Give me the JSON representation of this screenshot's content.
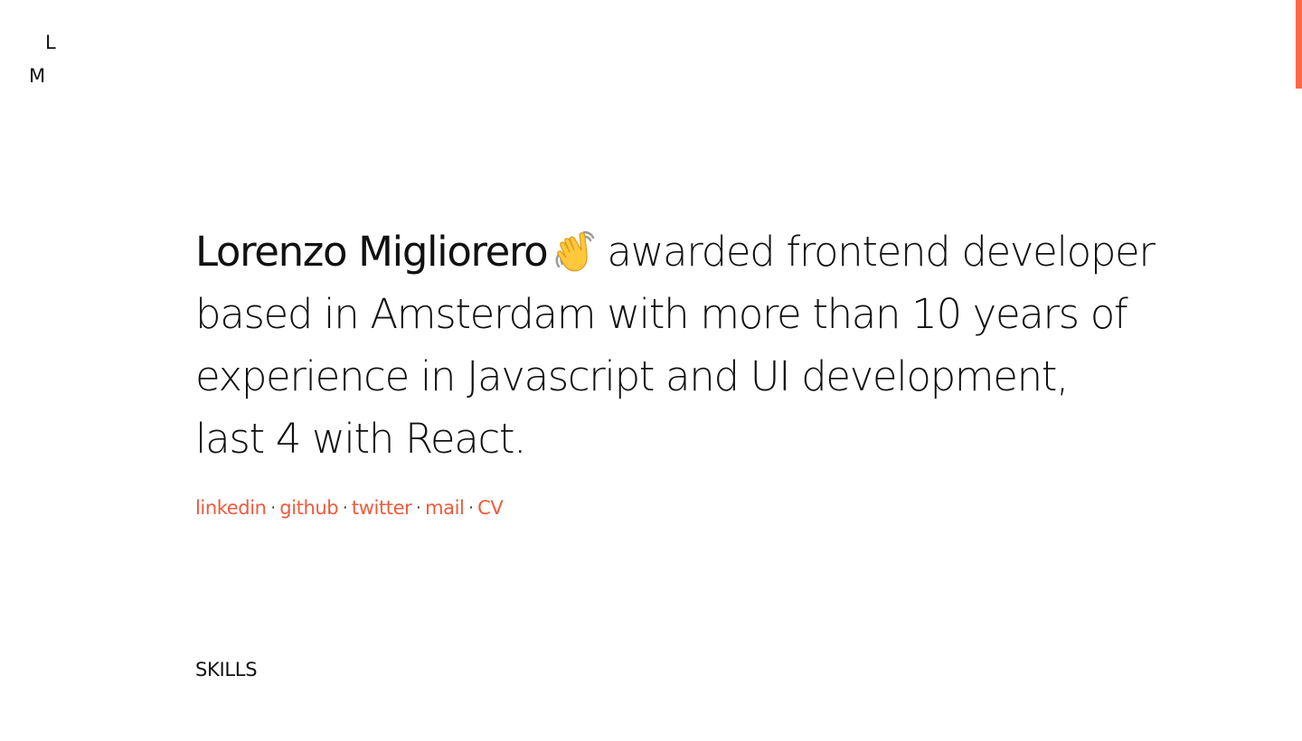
{
  "logo": {
    "first": "L",
    "second": "M"
  },
  "intro": {
    "name": "Lorenzo Migliorero",
    "wave_icon": "waving-hand-icon",
    "line1_rest": "awarded frontend developer",
    "line2": "based in Amsterdam with more than 10 years of",
    "line3": "experience in Javascript and UI development,",
    "line4": "last 4 with React."
  },
  "links": {
    "linkedin": "linkedin",
    "github": "github",
    "twitter": "twitter",
    "mail": "mail",
    "cv": "CV",
    "separator": "·"
  },
  "sections": {
    "skills_title": "SKILLS"
  },
  "colors": {
    "accent": "#ef5a3c",
    "scroll_indicator": "#ff6a45",
    "text": "#111111",
    "background": "#ffffff"
  }
}
